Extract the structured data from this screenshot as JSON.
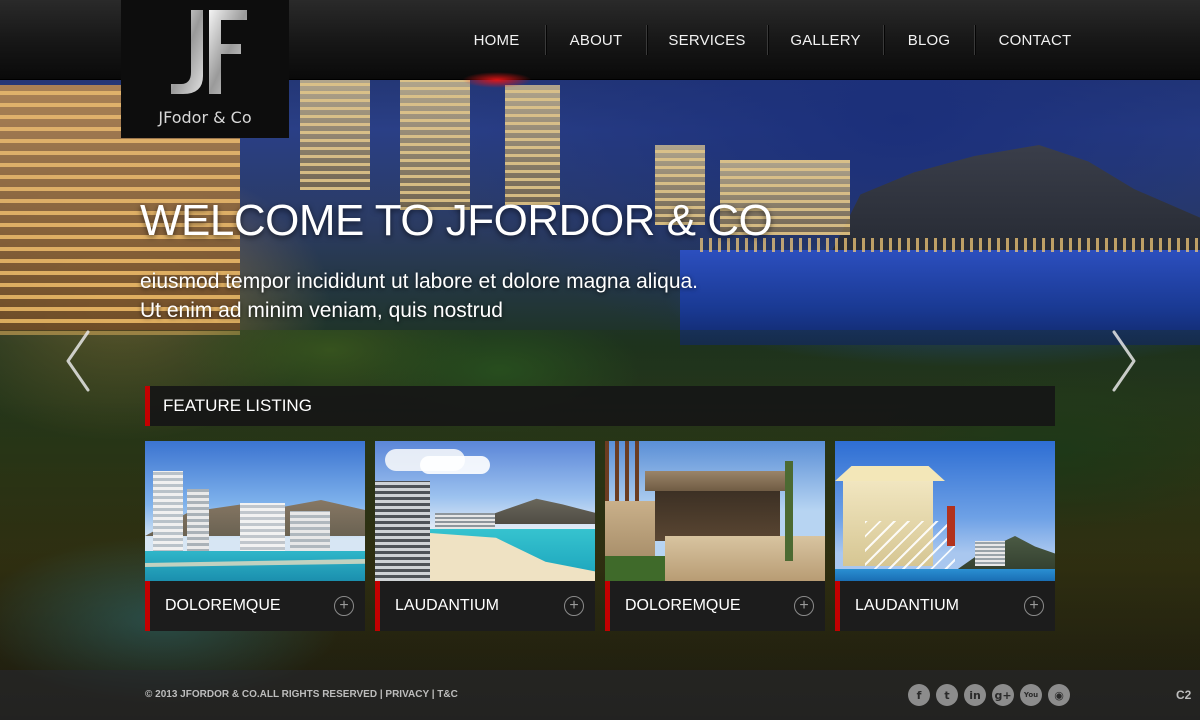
{
  "brand": {
    "logo_letters": "JF",
    "name": "JFodor & Co"
  },
  "nav": {
    "items": [
      {
        "label": "HOME",
        "active": true
      },
      {
        "label": "ABOUT",
        "active": false
      },
      {
        "label": "SERVICES",
        "active": false
      },
      {
        "label": "GALLERY",
        "active": false
      },
      {
        "label": "BLOG",
        "active": false
      },
      {
        "label": "CONTACT",
        "active": false
      }
    ]
  },
  "hero": {
    "title": "WELCOME TO JFORDOR & CO",
    "line1": "eiusmod tempor incididunt ut labore et dolore magna aliqua.",
    "line2": "Ut enim ad minim veniam, quis nostrud",
    "prev_icon": "chevron-left-icon",
    "next_icon": "chevron-right-icon"
  },
  "features": {
    "heading": "FEATURE LISTING",
    "cards": [
      {
        "title": "DOLOREMQUE",
        "icon": "plus-circle-icon"
      },
      {
        "title": "LAUDANTIUM",
        "icon": "plus-circle-icon"
      },
      {
        "title": "DOLOREMQUE",
        "icon": "plus-circle-icon"
      },
      {
        "title": "LAUDANTIUM",
        "icon": "plus-circle-icon"
      }
    ]
  },
  "footer": {
    "copyright": "© 2013 JFORDOR & CO.ALL RIGHTS RESERVED | PRIVACY | T&C",
    "corner_tag": "C2",
    "socials": [
      {
        "name": "facebook-icon",
        "glyph": "f"
      },
      {
        "name": "twitter-icon",
        "glyph": "t"
      },
      {
        "name": "linkedin-icon",
        "glyph": "in"
      },
      {
        "name": "googleplus-icon",
        "glyph": "g+"
      },
      {
        "name": "youtube-icon",
        "glyph": "You"
      },
      {
        "name": "rss-icon",
        "glyph": "◉"
      }
    ]
  },
  "colors": {
    "accent": "#c40000",
    "bar": "#161616",
    "text": "#ffffff"
  }
}
